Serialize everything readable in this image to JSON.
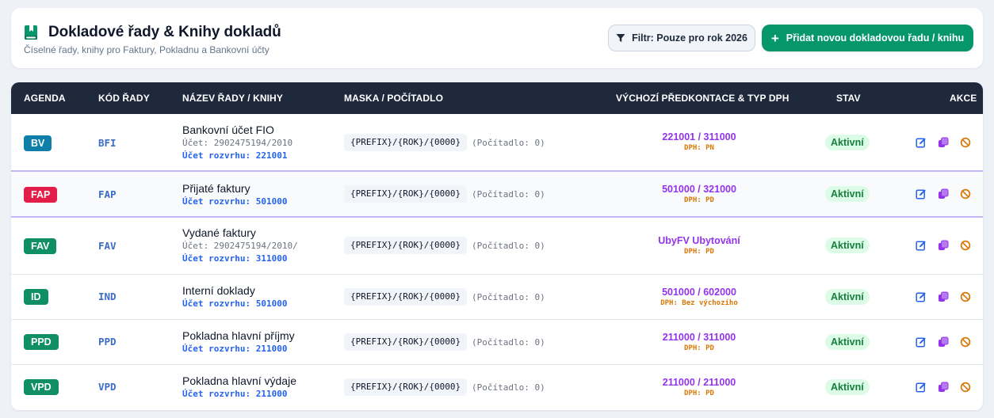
{
  "header": {
    "title": "Dokladové řady & Knihy dokladů",
    "subtitle": "Číselné řady, knihy pro Faktury, Pokladnu a Bankovní účty",
    "filter_label": "Filtr: Pouze pro rok 2026",
    "add_label": "Přidat novou dokladovou řadu / knihu",
    "add_icon": "+"
  },
  "columns": {
    "agenda": "AGENDA",
    "code": "KÓD ŘADY",
    "name": "NÁZEV ŘADY / KNIHY",
    "mask": "MASKA / POČÍTADLO",
    "predkontace": "VÝCHOZÍ PŘEDKONTACE & TYP DPH",
    "status": "STAV",
    "actions": "AKCE"
  },
  "colors": {
    "BV": "#0e7fa8",
    "FAP": "#e11d48",
    "FAV": "#0f8f63",
    "ID": "#0f8f63",
    "PPD": "#0f8f63",
    "VPD": "#0f8f63",
    "accent": "#059669",
    "predkontace": "#9333ea",
    "dph": "#d97706",
    "code": "#3b6cc4",
    "edit_icon": "#2563eb",
    "copy_icon": "#9333ea",
    "disable_icon": "#d97706"
  },
  "rows": [
    {
      "agenda": "BV",
      "code": "BFI",
      "name": "Bankovní účet FIO",
      "account": "Účet: 2902475194/2010",
      "rozvrh": "Účet rozvrhu: 221001",
      "mask": "{PREFIX}/{ROK}/{0000}",
      "counter": "(Počítadlo: 0)",
      "pk_main": "221001 / 311000",
      "pk_dph": "DPH: PN",
      "status": "Aktivní"
    },
    {
      "agenda": "FAP",
      "code": "FAP",
      "name": "Přijaté faktury",
      "account": "",
      "rozvrh": "Účet rozvrhu: 501000",
      "mask": "{PREFIX}/{ROK}/{0000}",
      "counter": "(Počítadlo: 0)",
      "pk_main": "501000 / 321000",
      "pk_dph": "DPH: PD",
      "status": "Aktivní"
    },
    {
      "agenda": "FAV",
      "code": "FAV",
      "name": "Vydané faktury",
      "account": "Účet: 2902475194/2010/",
      "rozvrh": "Účet rozvrhu: 311000",
      "mask": "{PREFIX}/{ROK}/{0000}",
      "counter": "(Počítadlo: 0)",
      "pk_main": "UbyFV Ubytování",
      "pk_dph": "DPH: PD",
      "status": "Aktivní"
    },
    {
      "agenda": "ID",
      "code": "IND",
      "name": "Interní doklady",
      "account": "",
      "rozvrh": "Účet rozvrhu: 501000",
      "mask": "{PREFIX}/{ROK}/{0000}",
      "counter": "(Počítadlo: 0)",
      "pk_main": "501000 / 602000",
      "pk_dph": "DPH: Bez výchozího",
      "status": "Aktivní"
    },
    {
      "agenda": "PPD",
      "code": "PPD",
      "name": "Pokladna hlavní příjmy",
      "account": "",
      "rozvrh": "Účet rozvrhu: 211000",
      "mask": "{PREFIX}/{ROK}/{0000}",
      "counter": "(Počítadlo: 0)",
      "pk_main": "211000 / 311000",
      "pk_dph": "DPH: PD",
      "status": "Aktivní"
    },
    {
      "agenda": "VPD",
      "code": "VPD",
      "name": "Pokladna hlavní výdaje",
      "account": "",
      "rozvrh": "Účet rozvrhu: 211000",
      "mask": "{PREFIX}/{ROK}/{0000}",
      "counter": "(Počítadlo: 0)",
      "pk_main": "211000 / 211000",
      "pk_dph": "DPH: PD",
      "status": "Aktivní"
    }
  ]
}
